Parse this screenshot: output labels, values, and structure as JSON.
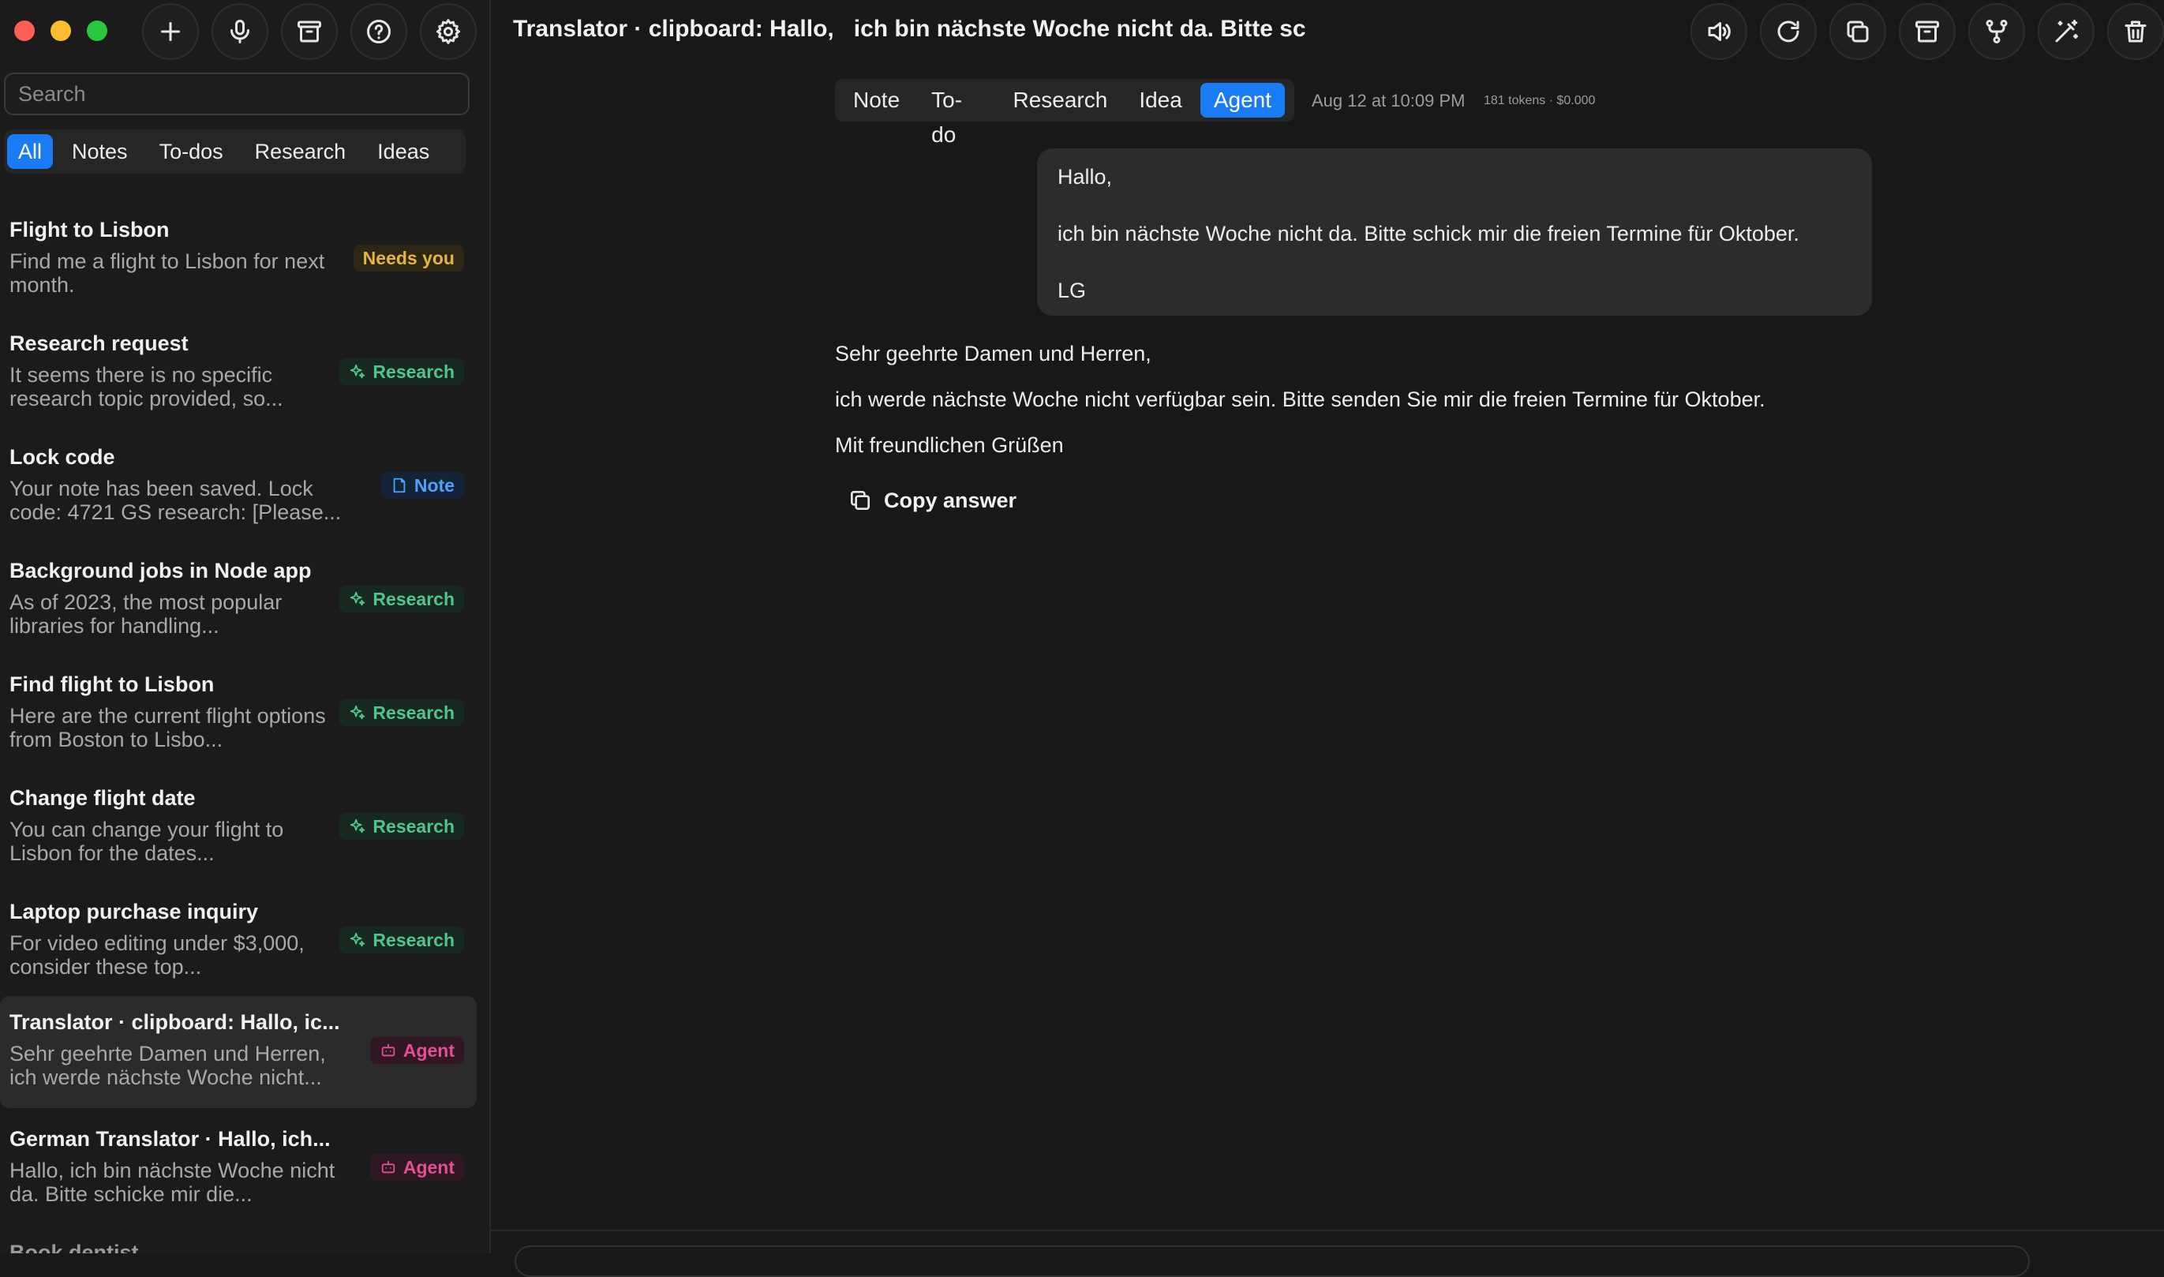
{
  "window": {
    "title": "Translator · clipboard: Hallo,   ich bin nächste Woche nicht da. Bitte sc"
  },
  "search": {
    "placeholder": "Search",
    "value": ""
  },
  "filters": [
    {
      "label": "All",
      "active": true
    },
    {
      "label": "Notes",
      "active": false
    },
    {
      "label": "To-dos",
      "active": false
    },
    {
      "label": "Research",
      "active": false
    },
    {
      "label": "Ideas",
      "active": false
    }
  ],
  "items": [
    {
      "title": "Flight to Lisbon",
      "snippet": "Find me a flight to Lisbon for next month.",
      "badge": "Needs you",
      "badge_type": "needs"
    },
    {
      "title": "Research request",
      "snippet": "It seems there is no specific research topic provided, so...",
      "badge": "Research",
      "badge_type": "research"
    },
    {
      "title": "Lock code",
      "snippet": "Your note has been saved. Lock code: 4721 GS research: [Please...",
      "badge": "Note",
      "badge_type": "note"
    },
    {
      "title": "Background jobs in Node app",
      "snippet": "As of 2023, the most popular libraries for handling...",
      "badge": "Research",
      "badge_type": "research"
    },
    {
      "title": "Find flight to Lisbon",
      "snippet": "Here are the current flight options from Boston to Lisbo...",
      "badge": "Research",
      "badge_type": "research"
    },
    {
      "title": "Change flight date",
      "snippet": "You can change your flight to Lisbon for the dates...",
      "badge": "Research",
      "badge_type": "research"
    },
    {
      "title": "Laptop purchase inquiry",
      "snippet": "For video editing under $3,000, consider these top...",
      "badge": "Research",
      "badge_type": "research"
    },
    {
      "title": "Translator · clipboard: Hallo,   ic...",
      "snippet": "Sehr geehrte Damen und Herren, ich werde nächste Woche nicht...",
      "badge": "Agent",
      "badge_type": "agent",
      "selected": true
    },
    {
      "title": "German Translator · Hallo,   ich...",
      "snippet": "Hallo, ich bin nächste Woche nicht da. Bitte schicke mir die...",
      "badge": "Agent",
      "badge_type": "agent"
    },
    {
      "title": "Book dentist",
      "snippet": "",
      "badge": "",
      "badge_type": ""
    }
  ],
  "type_tabs": [
    {
      "label": "Note",
      "active": false
    },
    {
      "label": "To-do",
      "active": false
    },
    {
      "label": "Research",
      "active": false
    },
    {
      "label": "Idea",
      "active": false
    },
    {
      "label": "Agent",
      "active": true
    }
  ],
  "meta": {
    "date": "Aug 12 at 10:09 PM",
    "tokens": "181 tokens · $0.000"
  },
  "user_message": {
    "greeting": "Hallo,",
    "body": "ich bin nächste Woche nicht da. Bitte schick mir die freien Termine für Oktober.",
    "signoff": "LG"
  },
  "answer": {
    "greeting": "Sehr geehrte Damen und Herren,",
    "body": "ich werde nächste Woche nicht verfügbar sein. Bitte senden Sie mir die freien Termine für Oktober.",
    "closing": "Mit freundlichen Grüßen"
  },
  "copy_label": "Copy answer",
  "colors": {
    "accent": "#1a7cf5",
    "research": "#4fc58b",
    "note": "#4aa3ff",
    "agent": "#e34e95",
    "needs_you": "#e5b63f"
  }
}
